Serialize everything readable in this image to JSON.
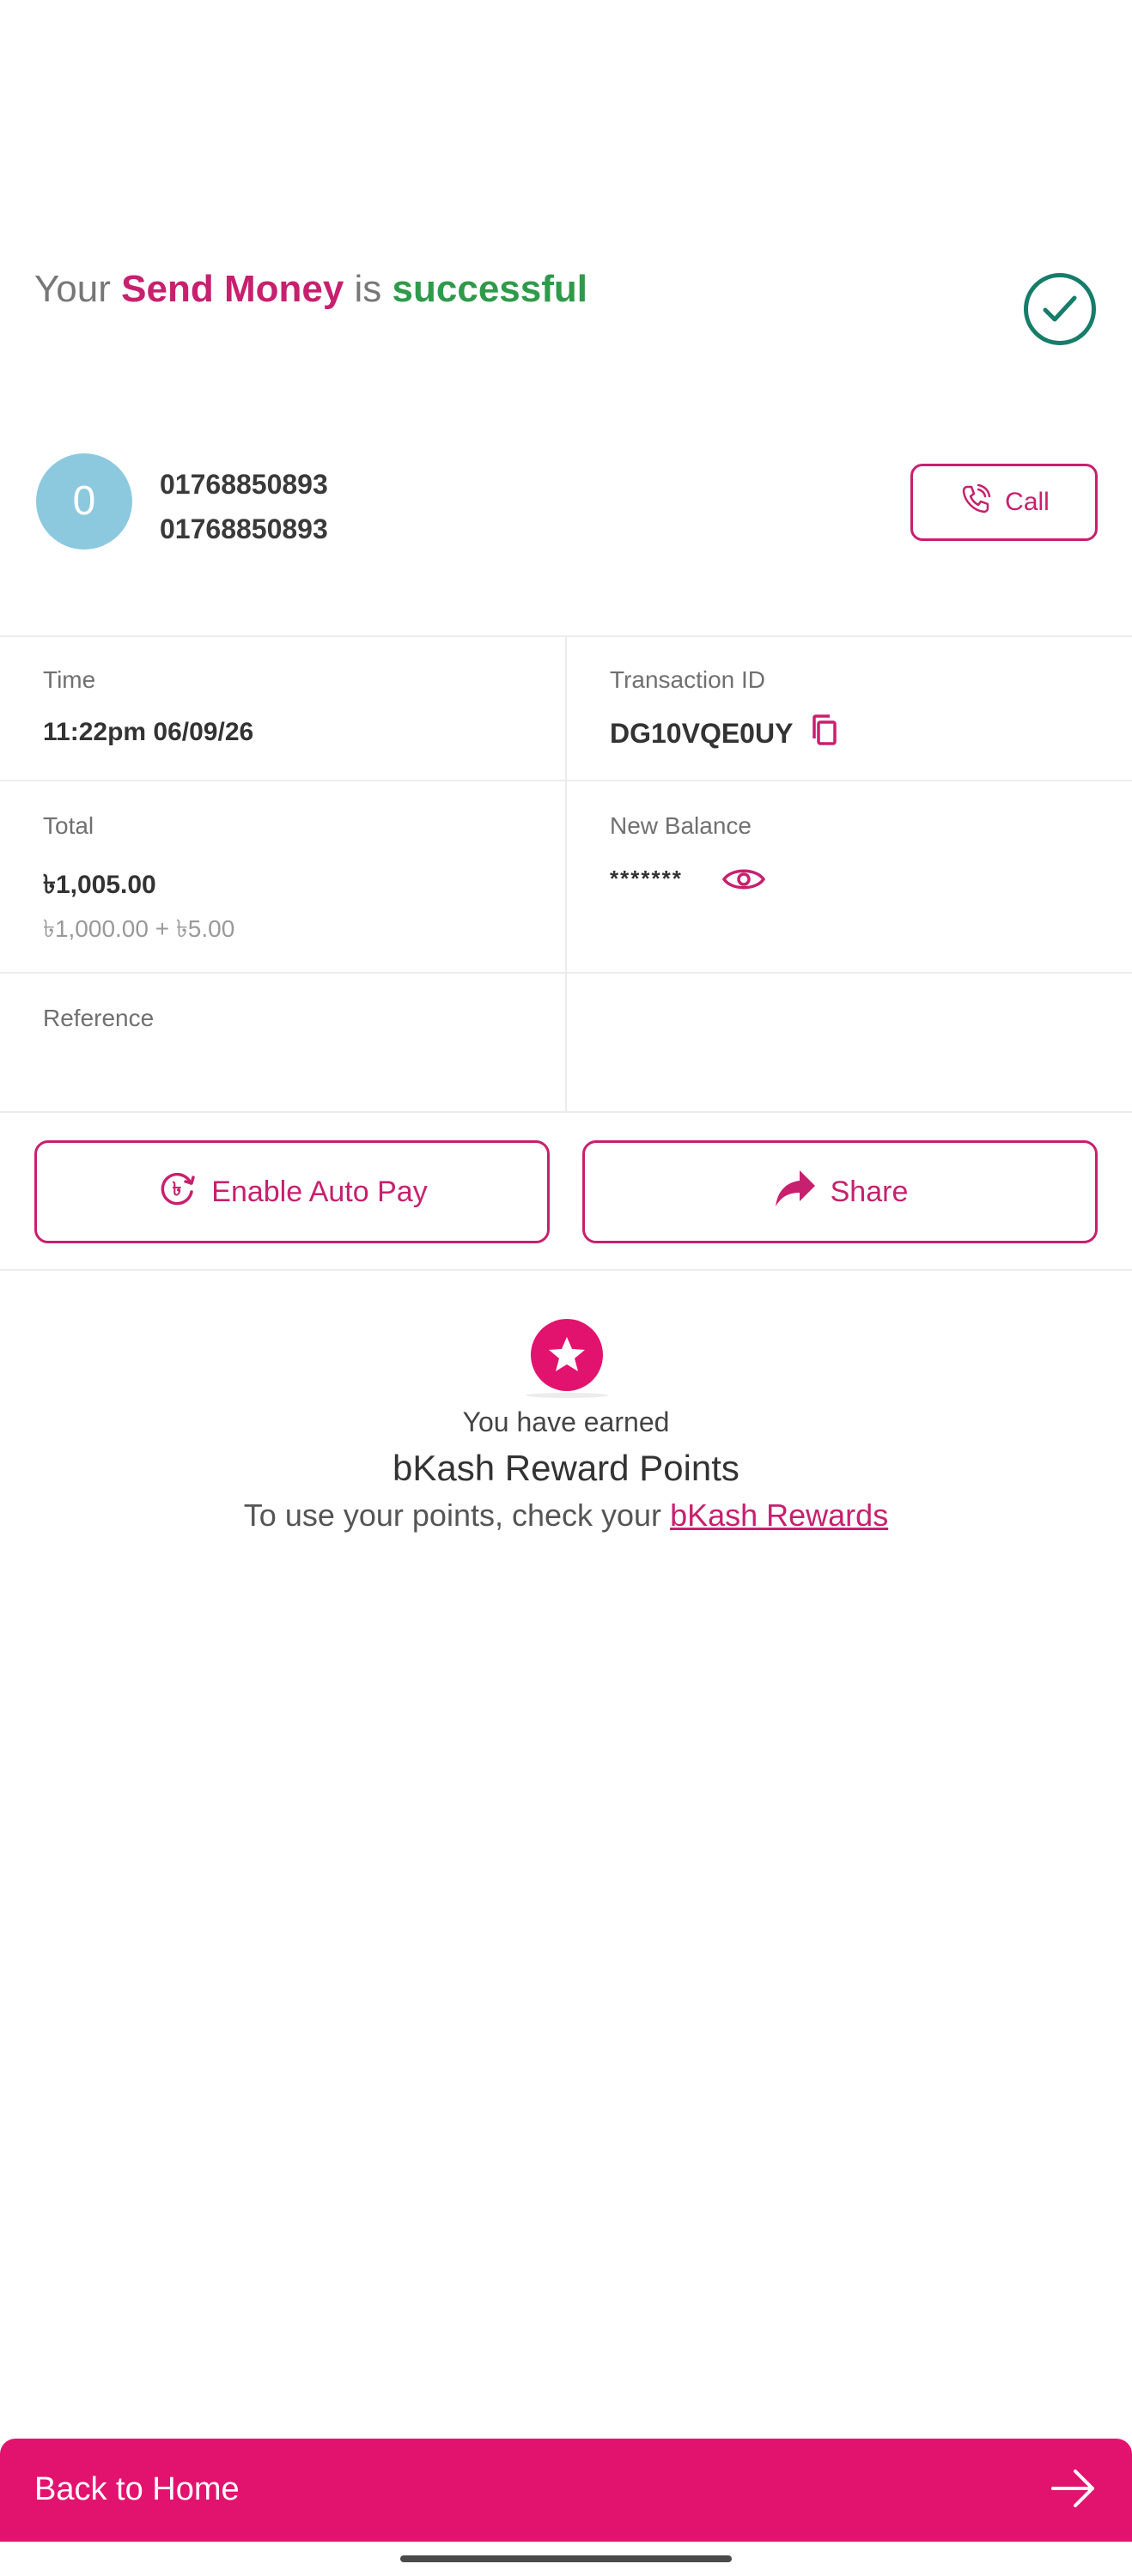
{
  "headline": {
    "prefix": "Your",
    "action": "Send Money",
    "middle": "is",
    "status": "successful"
  },
  "recipient": {
    "avatar_initial": "0",
    "name": "01768850893",
    "number": "01768850893",
    "call_label": "Call"
  },
  "details": {
    "time_label": "Time",
    "time_value": "11:22pm 06/09/26",
    "trx_label": "Transaction ID",
    "trx_value": "DG10VQE0UY",
    "total_label": "Total",
    "total_value": "৳1,005.00",
    "total_breakdown": "৳1,000.00 + ৳5.00",
    "balance_label": "New Balance",
    "balance_value": "*******",
    "reference_label": "Reference",
    "reference_value": ""
  },
  "actions": {
    "autopay_label": "Enable Auto Pay",
    "share_label": "Share"
  },
  "reward": {
    "earned_text": "You have earned",
    "title": "bKash Reward Points",
    "check_text": "To use your points, check your",
    "link_text": "bKash Rewards"
  },
  "footer": {
    "back_label": "Back to Home"
  },
  "icons": {
    "success": "check-circle-icon",
    "call": "phone-icon",
    "copy": "copy-icon",
    "reveal": "eye-icon",
    "autopay": "taka-refresh-icon",
    "share": "share-arrow-icon",
    "reward": "star-icon",
    "forward": "arrow-right-icon"
  },
  "colors": {
    "brand": "#e2136e",
    "brand_text": "#c7206e",
    "success_text": "#2e9a4a",
    "check_ring": "#167d6a",
    "avatar_bg": "#8cc9df"
  }
}
